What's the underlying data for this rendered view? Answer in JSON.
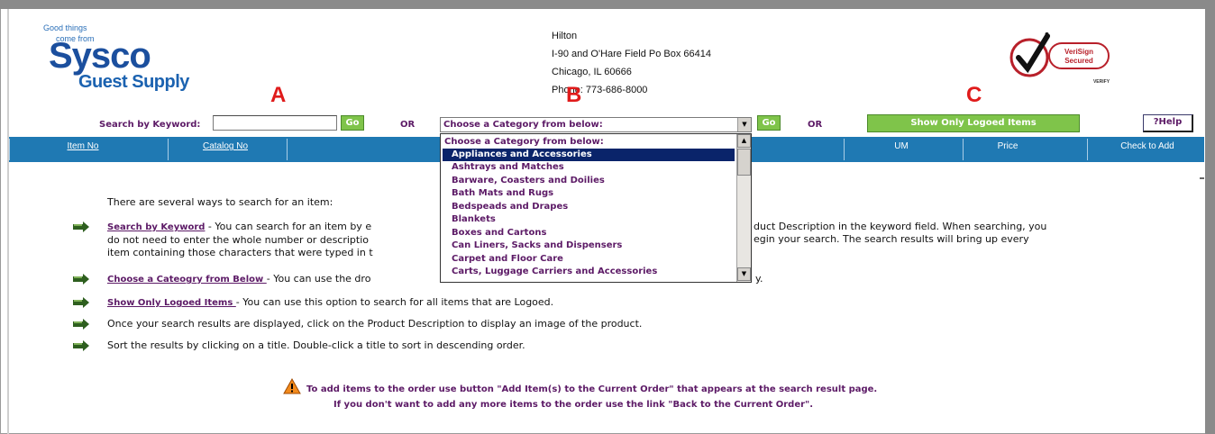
{
  "logo": {
    "tagline1": "Good things",
    "tagline2": "come from",
    "brand": "Sysco",
    "sub": "Guest Supply"
  },
  "address": {
    "name": "Hilton",
    "line1": "I-90 and O'Hare Field Po Box 66414",
    "line2": "Chicago, IL 60666",
    "phone": "Phone: 773-686-8000"
  },
  "verisign": {
    "line1": "VeriSign",
    "line2": "Secured",
    "line3": "VERIFY"
  },
  "annotations": {
    "a": "A",
    "b": "B",
    "c": "C"
  },
  "search": {
    "keyword_label": "Search by Keyword:",
    "keyword_value": "",
    "go_label": "Go",
    "or_label": "OR",
    "category_value": "Choose a Category from below:",
    "logoed_label": "Show Only Logoed Items",
    "help_label": "?Help"
  },
  "header": {
    "columns": [
      "Item No",
      "Catalog No",
      "UM",
      "Price",
      "Check to Add"
    ]
  },
  "dropdown": {
    "items": [
      "Choose a Category from below:",
      "Appliances and Accessories",
      "Ashtrays and Matches",
      "Barware, Coasters and Doilies",
      "Bath Mats and Rugs",
      "Bedspeads and Drapes",
      "Blankets",
      "Boxes and Cartons",
      "Can Liners, Sacks and Dispensers",
      "Carpet and Floor Care",
      "Carts, Luggage Carriers and Accessories"
    ],
    "selected_index": 1
  },
  "content": {
    "intro": "There are several ways to search for an item:",
    "keyword_link": "Search by Keyword",
    "keyword_text1": " - You can search for an item by e",
    "keyword_text1b": "duct Description in the keyword field.  When searching, you",
    "keyword_text2": "do not need to enter the whole number or descriptio",
    "keyword_text2b": "egin your search. The search results will bring up every",
    "keyword_text3": "item containing those characters that were typed in t",
    "category_link": "Choose a Cateogry from Below ",
    "category_text": "- You can use the dro",
    "category_tail": "y.",
    "logoed_link": "Show Only Logoed Items ",
    "logoed_text": "- You can use this option to search for all items that are Logoed.",
    "results_text": "Once your search results are displayed, click on the Product Description to display an image of the product.",
    "sort_text": "Sort the results by clicking on a title. Double-click a title to sort in descending order.",
    "note1": "To add items to the order use button \"Add Item(s) to the Current Order\" that appears at the search result page.",
    "note2": "If you don't want to add any more items to the order use the link \"Back to the Current Order\"."
  },
  "colors": {
    "header_bar": "#1f79b3",
    "button_green": "#7fc44a",
    "link_purple": "#5c1a66",
    "annotation_red": "#e01b1b"
  }
}
